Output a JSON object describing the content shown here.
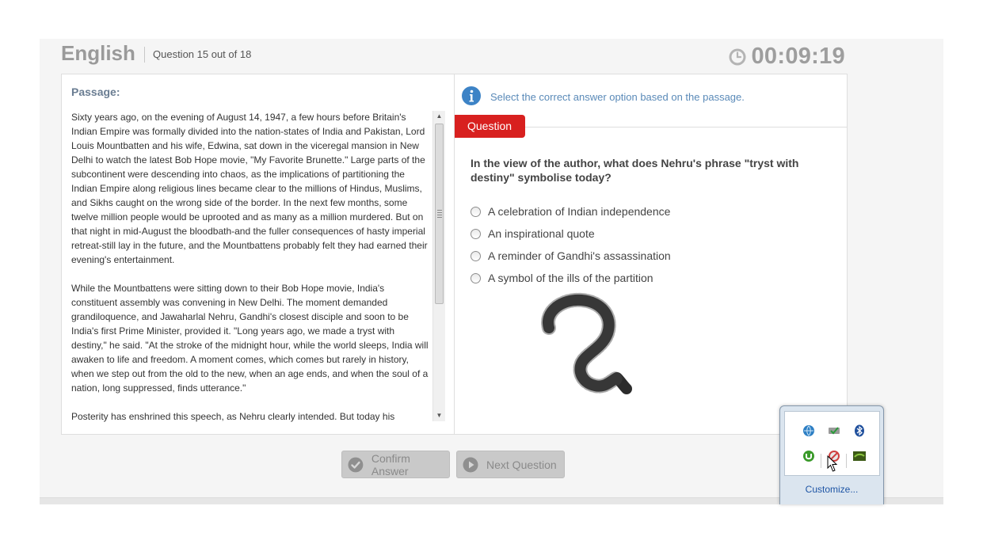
{
  "header": {
    "subject": "English",
    "question_counter": "Question 15 out of 18",
    "timer": "00:09:19",
    "timer_icon": "clock-icon"
  },
  "passage": {
    "label": "Passage:",
    "paragraphs": [
      "Sixty years ago, on the evening of August 14, 1947, a few hours before Britain's Indian Empire was formally divided into the nation-states of India and Pakistan, Lord Louis Mountbatten and his wife, Edwina, sat down in the viceregal mansion in New Delhi to watch the latest Bob Hope movie, \"My Favorite Brunette.\" Large parts of the subcontinent were descending into chaos, as the implications of partitioning the Indian Empire along religious lines became clear to the millions of Hindus, Muslims, and Sikhs caught on the wrong side of the border. In the next few months, some twelve million people would be uprooted and as many as a million murdered. But on that night in mid-August the bloodbath-and the fuller consequences of hasty imperial retreat-still lay in the future, and the Mountbattens probably felt they had earned their evening's entertainment.",
      "While the Mountbattens were sitting down to their Bob Hope movie, India's constituent assembly was convening in New Delhi. The moment demanded grandiloquence, and Jawaharlal Nehru, Gandhi's closest disciple and soon to be India's first Prime Minister, provided it. \"Long years ago, we made a tryst with destiny,\" he said. \"At the stroke of the midnight hour, while the world sleeps, India will awaken to life and freedom. A moment comes, which comes but rarely in history, when we step out from the old to the new, when an age ends, and when the soul of a nation, long suppressed, finds utterance.\"",
      "Posterity has enshrined this speech, as Nehru clearly intended. But today his"
    ]
  },
  "question_panel": {
    "instruction": "Select the correct answer option based on the passage.",
    "info_icon": "info-icon",
    "tab_label": "Question",
    "question_text": "In the view of the author, what does Nehru's phrase \"tryst with destiny\" symbolise today?",
    "options": [
      "A celebration of Indian independence",
      "An inspirational quote",
      "A reminder of Gandhi's assassination",
      "A symbol of the ills of the partition"
    ],
    "annotation": "handwritten-scribble"
  },
  "buttons": {
    "confirm": "Confirm Answer",
    "next": "Next Question"
  },
  "tray": {
    "customize": "Customize...",
    "icons": [
      "network-globe-icon",
      "security-shield-icon",
      "bluetooth-icon",
      "utorrent-icon",
      "blocked-icon",
      "nvidia-icon"
    ]
  }
}
